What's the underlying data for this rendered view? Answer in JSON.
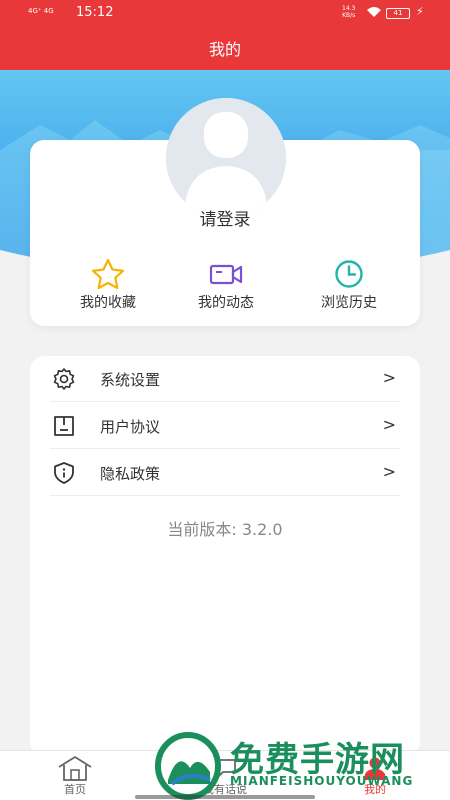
{
  "status_bar": {
    "signal": "4G⁺ 4G",
    "time": "15:12",
    "net_speed": "14.3",
    "net_unit": "KB/s",
    "battery": "41"
  },
  "header": {
    "title": "我的"
  },
  "profile": {
    "login_label": "请登录"
  },
  "quick_actions": [
    {
      "label": "我的收藏",
      "icon": "star-icon"
    },
    {
      "label": "我的动态",
      "icon": "video-camera-icon"
    },
    {
      "label": "浏览历史",
      "icon": "clock-icon"
    }
  ],
  "menu": [
    {
      "label": "系统设置",
      "icon": "gear-icon",
      "arrow": ">"
    },
    {
      "label": "用户协议",
      "icon": "document-icon",
      "arrow": ">"
    },
    {
      "label": "隐私政策",
      "icon": "shield-info-icon",
      "arrow": ">"
    }
  ],
  "version": "当前版本: 3.2.0",
  "tabs": [
    {
      "label": "首页",
      "icon": "house-icon"
    },
    {
      "label": "我有话说",
      "icon": "chat-icon"
    },
    {
      "label": "我的",
      "icon": "person-icon"
    }
  ],
  "watermark": {
    "cn": "免费手游网",
    "en": "MIANFEISHOUYOUWANG"
  },
  "colors": {
    "brand_red": "#e8383a",
    "banner_blue": "#3aa0eb",
    "star": "#f5b400",
    "video": "#7a4fd6",
    "clock": "#1fb5a8"
  }
}
